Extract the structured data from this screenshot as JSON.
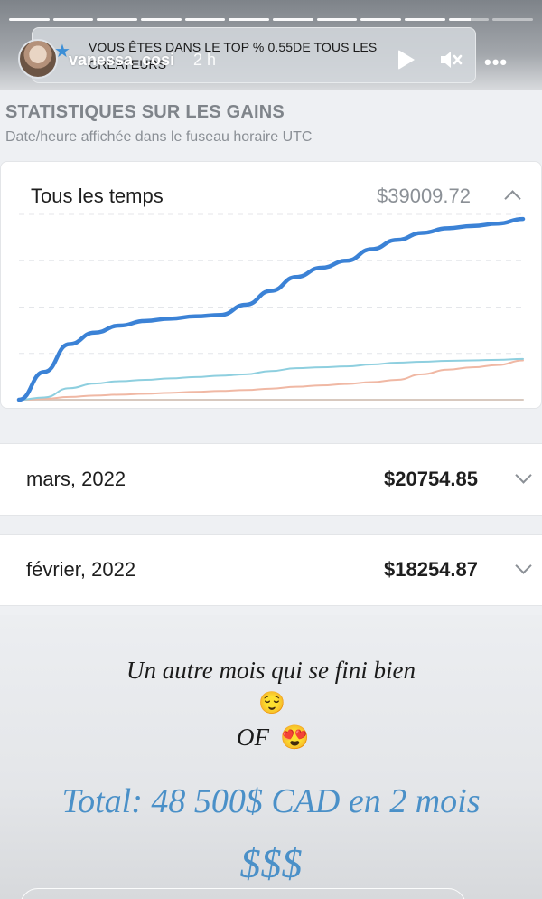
{
  "story": {
    "progress_segments": 12,
    "current_segment": 11,
    "banner_text": "VOUS ÊTES DANS LE TOP % 0.55DE TOUS LES CRÉATEURS",
    "username": "vanessa_cosi",
    "time_ago": "2 h",
    "icons": {
      "avatar": "avatar",
      "badge": "star-icon",
      "play": "play-icon",
      "mute": "mute-icon",
      "more": "more-icon"
    }
  },
  "stats": {
    "title": "STATISTIQUES SUR LES GAINS",
    "subtitle": "Date/heure affichée dans le fuseau horaire UTC"
  },
  "all_time": {
    "label": "Tous les temps",
    "value": "$39009.72",
    "value_color": "#8b9096",
    "icon": "chevron-up-icon"
  },
  "months": [
    {
      "label": "mars, 2022",
      "value": "$20754.85",
      "icon": "chevron-down-icon"
    },
    {
      "label": "février, 2022",
      "value": "$18254.87",
      "icon": "chevron-down-icon"
    }
  ],
  "caption": {
    "line1": "Un autre mois qui se fini bien",
    "emoji1": "😌",
    "line2": "OF",
    "emoji2": "😍",
    "line3": "Total: 48 500$ CAD en 2 mois",
    "line4": "$$$"
  },
  "chart_data": {
    "type": "line",
    "title": "",
    "xlabel": "",
    "ylabel": "",
    "grid": true,
    "legend": "none",
    "x": [
      0,
      1,
      2,
      3,
      4,
      5,
      6,
      7,
      8,
      9,
      10,
      11,
      12,
      13,
      14,
      15,
      16,
      17,
      18,
      19,
      20
    ],
    "ylim": [
      0,
      40000
    ],
    "series": [
      {
        "color": "#3b82d6",
        "values": [
          0,
          6000,
          12000,
          14500,
          16000,
          17000,
          17500,
          18000,
          18300,
          20500,
          23500,
          26500,
          28500,
          30000,
          32500,
          34500,
          36000,
          37000,
          37500,
          38000,
          39009.72
        ]
      },
      {
        "color": "#8ecfdf",
        "values": [
          0,
          500,
          2500,
          3500,
          4000,
          4300,
          4600,
          4900,
          5200,
          5500,
          6200,
          6800,
          7000,
          7200,
          7600,
          8000,
          8200,
          8400,
          8500,
          8600,
          8800
        ]
      },
      {
        "color": "#f0b8a4",
        "values": [
          0,
          200,
          600,
          900,
          1100,
          1300,
          1500,
          1700,
          1900,
          2100,
          2400,
          2800,
          3100,
          3400,
          3800,
          4300,
          5500,
          6500,
          7000,
          7500,
          8500
        ]
      },
      {
        "color": "#d8c9bf",
        "values": [
          0,
          0,
          0,
          0,
          0,
          0,
          0,
          0,
          0,
          0,
          0,
          0,
          0,
          0,
          0,
          0,
          0,
          0,
          0,
          0,
          0
        ]
      }
    ]
  }
}
